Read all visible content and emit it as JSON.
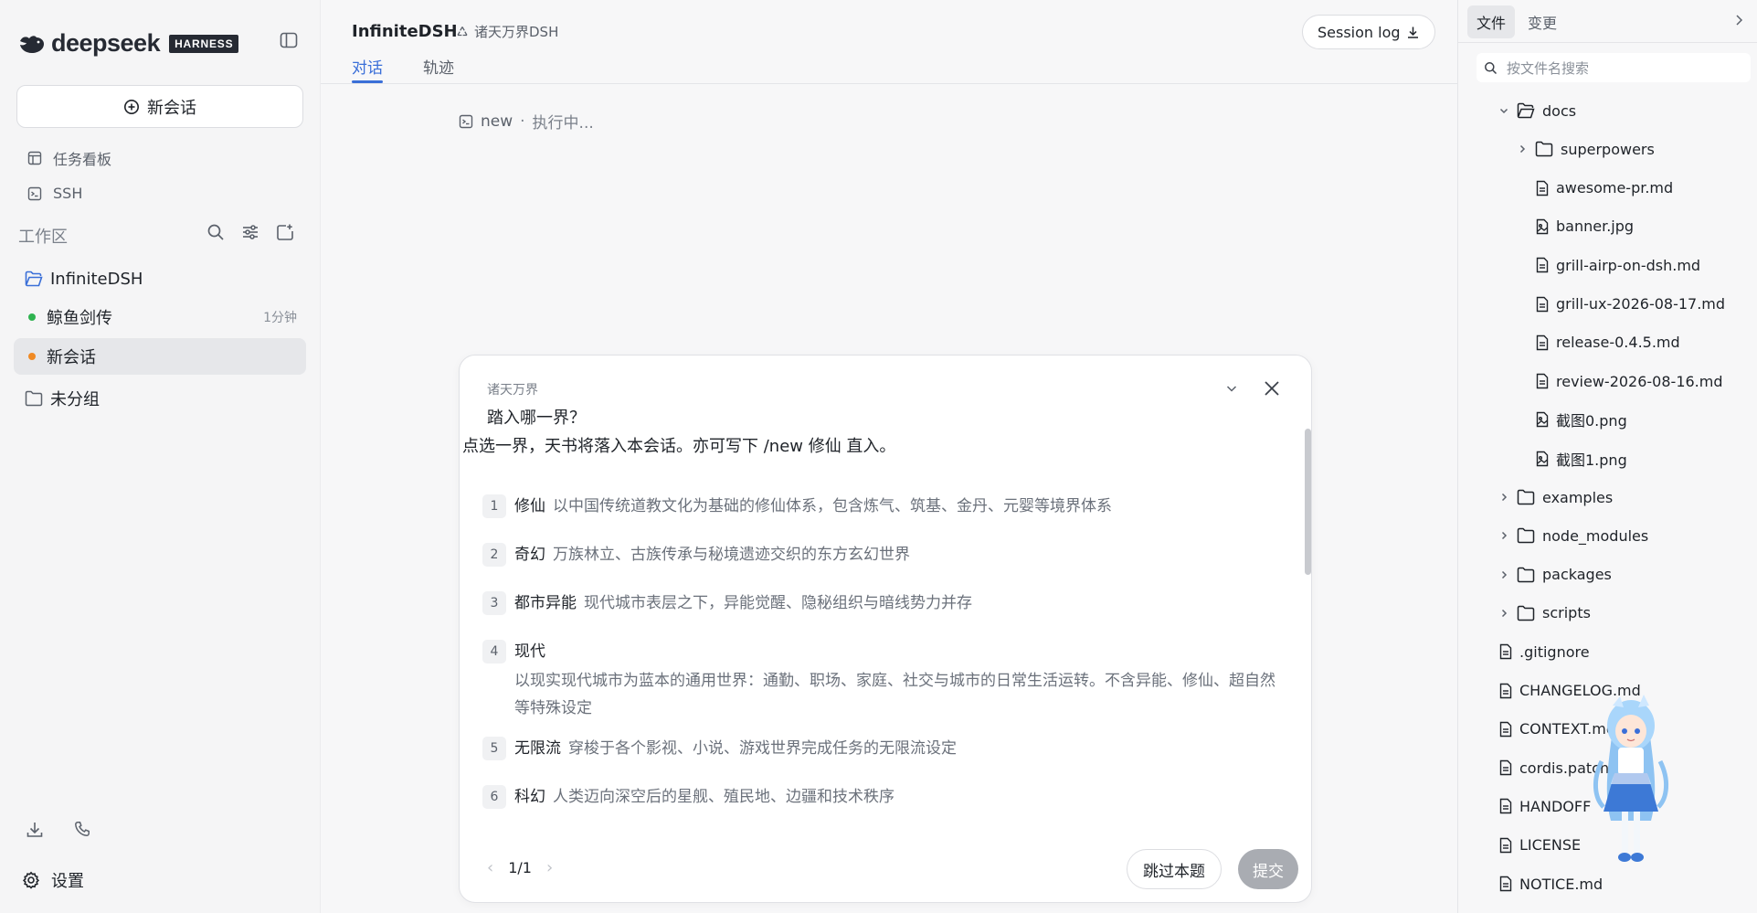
{
  "app": {
    "logo_word": "deepseek",
    "logo_badge": "HARNESS"
  },
  "sidebar": {
    "new_chat_label": "新会话",
    "nav": [
      {
        "label": "任务看板",
        "icon": "kanban-icon"
      },
      {
        "label": "SSH",
        "icon": "terminal-icon"
      }
    ],
    "workspace_label": "工作区",
    "tree": [
      {
        "label": "InfiniteDSH",
        "type": "folder-open"
      },
      {
        "label": "鲸鱼剑传",
        "type": "session",
        "status_color": "#2fb350",
        "time": "1分钟"
      },
      {
        "label": "新会话",
        "type": "session",
        "status_color": "#f08a24",
        "selected": true
      },
      {
        "label": "未分组",
        "type": "folder"
      }
    ],
    "settings_label": "设置"
  },
  "main": {
    "title": "InfiniteDSH",
    "subtitle": "诸天万界DSH",
    "session_log_label": "Session log",
    "tabs": [
      {
        "label": "对话",
        "active": true
      },
      {
        "label": "轨迹",
        "active": false
      }
    ],
    "status_name": "new",
    "status_sep": "·",
    "status_text": "执行中..."
  },
  "card": {
    "header": "诸天万界",
    "question": "踏入哪一界？",
    "hint": "点选一界，天书将落入本会话。亦可写下 /new 修仙 直入。",
    "options": [
      {
        "num": "1",
        "name": "修仙",
        "desc": "以中国传统道教文化为基础的修仙体系，包含炼气、筑基、金丹、元婴等境界体系"
      },
      {
        "num": "2",
        "name": "奇幻",
        "desc": "万族林立、古族传承与秘境遗迹交织的东方玄幻世界"
      },
      {
        "num": "3",
        "name": "都市异能",
        "desc": "现代城市表层之下，异能觉醒、隐秘组织与暗线势力并存"
      },
      {
        "num": "4",
        "name": "现代",
        "desc": "以现实现代城市为蓝本的通用世界：通勤、职场、家庭、社交与城市的日常生活运转。不含异能、修仙、超自然等特殊设定"
      },
      {
        "num": "5",
        "name": "无限流",
        "desc": "穿梭于各个影视、小说、游戏世界完成任务的无限流设定"
      },
      {
        "num": "6",
        "name": "科幻",
        "desc": "人类迈向深空后的星舰、殖民地、边疆和技术秩序"
      }
    ],
    "pager": "1/1",
    "skip_label": "跳过本题",
    "submit_label": "提交"
  },
  "files_panel": {
    "tabs": [
      {
        "label": "文件",
        "active": true
      },
      {
        "label": "变更",
        "active": false
      }
    ],
    "search_placeholder": "按文件名搜索",
    "items": [
      {
        "name": "docs",
        "kind": "folder-open",
        "chev": "down"
      },
      {
        "name": "superpowers",
        "kind": "folder",
        "chev": "right"
      },
      {
        "name": "awesome-pr.md",
        "kind": "file"
      },
      {
        "name": "banner.jpg",
        "kind": "image"
      },
      {
        "name": "grill-airp-on-dsh.md",
        "kind": "file"
      },
      {
        "name": "grill-ux-2026-08-17.md",
        "kind": "file"
      },
      {
        "name": "release-0.4.5.md",
        "kind": "file"
      },
      {
        "name": "review-2026-08-16.md",
        "kind": "file"
      },
      {
        "name": "截图0.png",
        "kind": "image"
      },
      {
        "name": "截图1.png",
        "kind": "image"
      },
      {
        "name": "examples",
        "kind": "folder",
        "chev": "right"
      },
      {
        "name": "node_modules",
        "kind": "folder",
        "chev": "right"
      },
      {
        "name": "packages",
        "kind": "folder",
        "chev": "right"
      },
      {
        "name": "scripts",
        "kind": "folder",
        "chev": "right"
      },
      {
        "name": ".gitignore",
        "kind": "file"
      },
      {
        "name": "CHANGELOG.md",
        "kind": "file"
      },
      {
        "name": "CONTEXT.md",
        "kind": "file"
      },
      {
        "name": "cordis.patch",
        "kind": "file"
      },
      {
        "name": "HANDOFF",
        "kind": "file"
      },
      {
        "name": "LICENSE",
        "kind": "file"
      },
      {
        "name": "NOTICE.md",
        "kind": "file"
      }
    ]
  },
  "colors": {
    "accent": "#3a6fd8",
    "online": "#2fb350",
    "busy": "#f08a24"
  }
}
